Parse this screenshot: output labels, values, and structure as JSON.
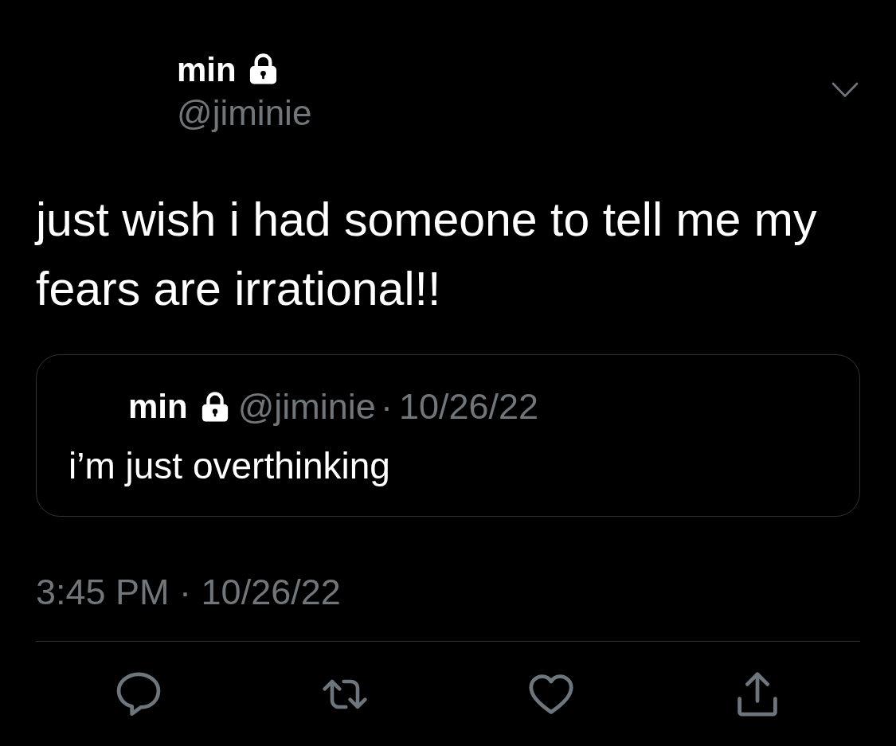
{
  "author": {
    "name": "min",
    "protected": true,
    "handle": "@jiminie"
  },
  "tweet": {
    "text": "just wish i had someone to tell me my fears are irrational!!"
  },
  "quoted_tweet": {
    "author": {
      "name": "min",
      "protected": true,
      "handle": "@jiminie"
    },
    "separator": "·",
    "date": "10/26/22",
    "text": "i’m just overthinking"
  },
  "timestamp": "3:45 PM · 10/26/22",
  "actions": [
    {
      "kind": "reply"
    },
    {
      "kind": "retweet"
    },
    {
      "kind": "like"
    },
    {
      "kind": "share"
    }
  ]
}
